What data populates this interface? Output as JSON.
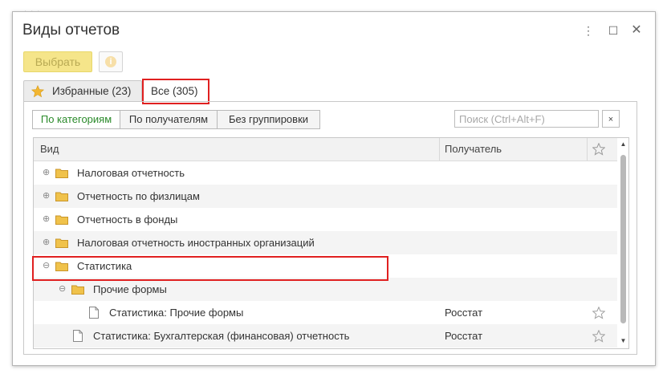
{
  "window": {
    "title": "Виды отчетов"
  },
  "toolbar": {
    "select_label": "Выбрать",
    "info_label": "i"
  },
  "tabs": [
    {
      "label": "Избранные (23)"
    },
    {
      "label": "Все (305)"
    }
  ],
  "filters": {
    "groupings": [
      "По категориям",
      "По получателям",
      "Без группировки"
    ],
    "search_placeholder": "Поиск (Ctrl+Alt+F)",
    "clear_label": "×"
  },
  "table": {
    "columns": [
      "Вид",
      "Получатель"
    ],
    "rows": [
      {
        "name": "Налоговая отчетность",
        "recipient": ""
      },
      {
        "name": "Отчетность по физлицам",
        "recipient": ""
      },
      {
        "name": "Отчетность в фонды",
        "recipient": ""
      },
      {
        "name": "Налоговая отчетность иностранных организаций",
        "recipient": ""
      },
      {
        "name": "Статистика",
        "recipient": ""
      },
      {
        "name": "Прочие формы",
        "recipient": ""
      },
      {
        "name": "Статистика: Прочие формы",
        "recipient": "Росстат"
      },
      {
        "name": "Статистика: Бухгалтерская (финансовая) отчетность",
        "recipient": "Росстат"
      }
    ]
  },
  "colors": {
    "accent_yellow": "#f5e58a",
    "highlight_red": "#e02020",
    "active_green": "#2a8a2a",
    "folder": "#f0c24b"
  }
}
